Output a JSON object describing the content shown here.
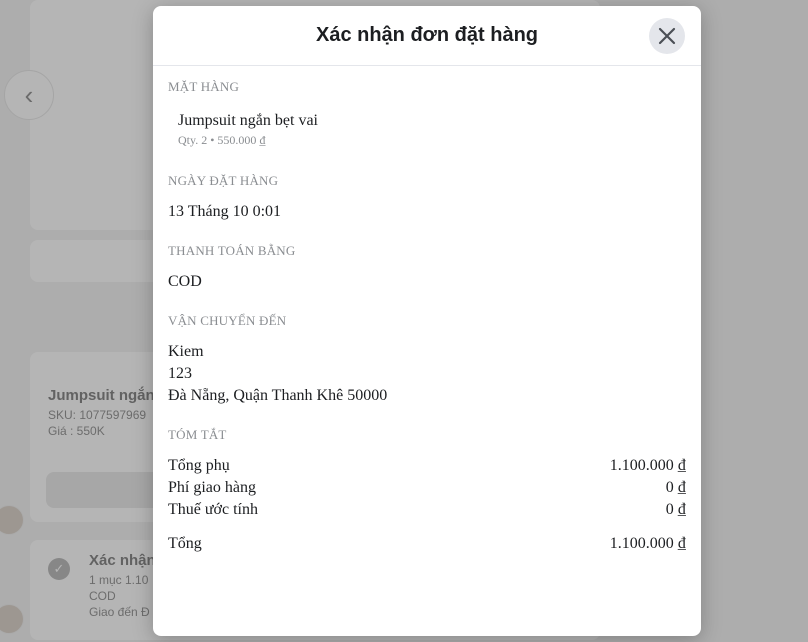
{
  "background": {
    "product_name": "Jumpsuit ngắn",
    "sku": "SKU: 1077597969",
    "price": "Giá : 550K",
    "order_title": "Xác nhận",
    "order_items": "1 mục 1.10",
    "order_payment": "COD",
    "order_delivery": "Giao đến Đ"
  },
  "modal": {
    "title": "Xác nhận đơn đặt hàng",
    "sections": {
      "items_label": "MẶT HÀNG",
      "item_name": "Jumpsuit ngắn bẹt vai",
      "item_meta": "Qty. 2 • 550.000 ₫",
      "date_label": "NGÀY ĐẶT HÀNG",
      "date_value": "13 Tháng 10 0:01",
      "payment_label": "THANH TOÁN BẰNG",
      "payment_value": "COD",
      "shipping_label": "VẬN CHUYỂN ĐẾN",
      "ship_name": "Kiem",
      "ship_line1": "123",
      "ship_line2": "Đà Nẵng, Quận Thanh Khê 50000",
      "summary_label": "TÓM TẮT"
    },
    "summary": {
      "subtotal_label": "Tổng phụ",
      "subtotal_value": "1.100.000 ₫",
      "shipping_label": "Phí giao hàng",
      "shipping_value": "0 ₫",
      "tax_label": "Thuế ước tính",
      "tax_value": "0 ₫",
      "total_label": "Tổng",
      "total_value": "1.100.000 ₫"
    }
  }
}
